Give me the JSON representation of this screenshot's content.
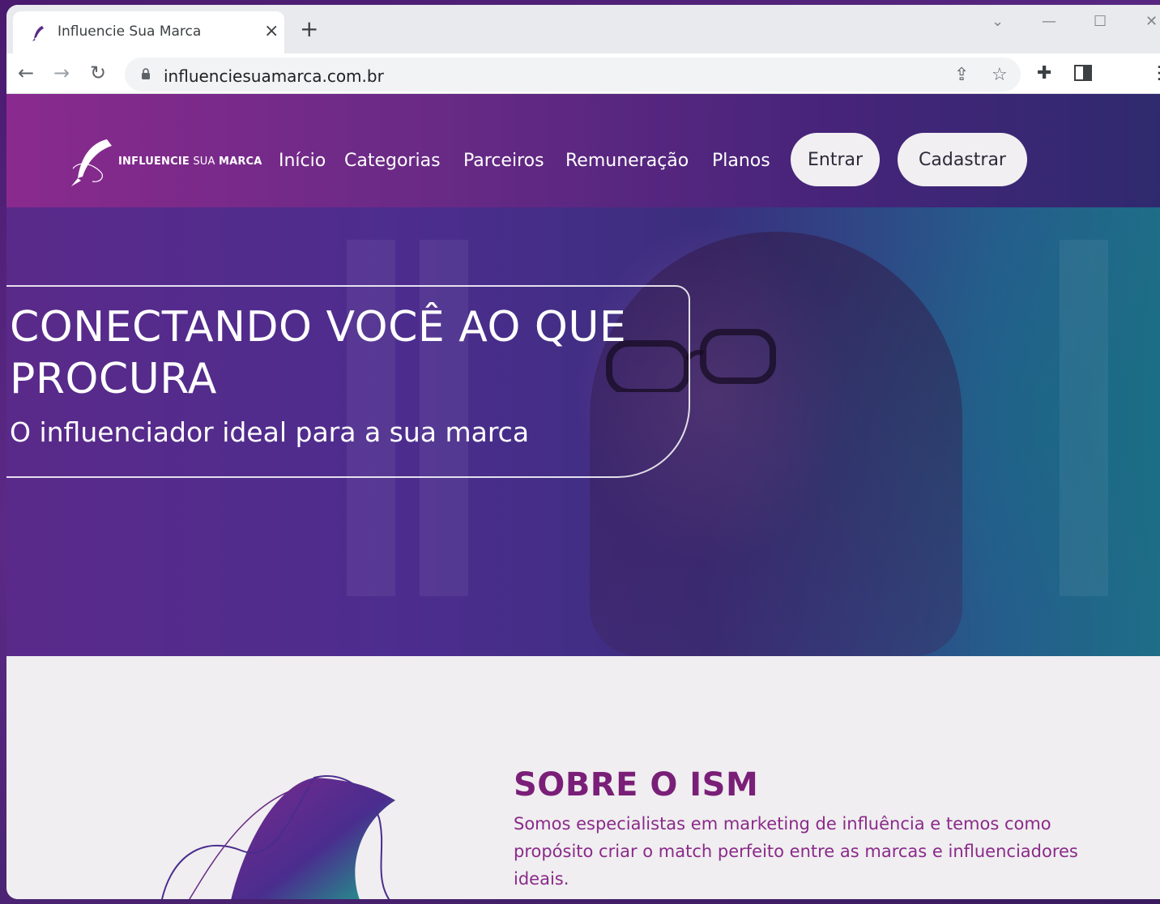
{
  "browser": {
    "tab_title": "Influencie Sua Marca",
    "tab_close": "×",
    "new_tab": "+",
    "url": "influenciesuamarca.com.br"
  },
  "site": {
    "logo_bold": "INFLUENCIE",
    "logo_light": "SUA",
    "logo_bold2": "MARCA",
    "nav": [
      "Início",
      "Categorias",
      "Parceiros",
      "Remuneração",
      "Planos"
    ],
    "login_label": "Entrar",
    "signup_label": "Cadastrar"
  },
  "hero": {
    "title": "CONECTANDO VOCÊ AO QUE PROCURA",
    "subtitle": "O influenciador ideal para a sua marca"
  },
  "about": {
    "title": "SOBRE O ISM",
    "text": "Somos especialistas em marketing de influência e temos como propósito criar o match perfeito entre as marcas e influenciadores ideais."
  },
  "colors": {
    "header_start": "#8a2a8e",
    "header_end": "#2e2a6e",
    "about_title": "#7a1f78",
    "about_text": "#8a2a8a",
    "about_bg": "#f0eef0"
  }
}
